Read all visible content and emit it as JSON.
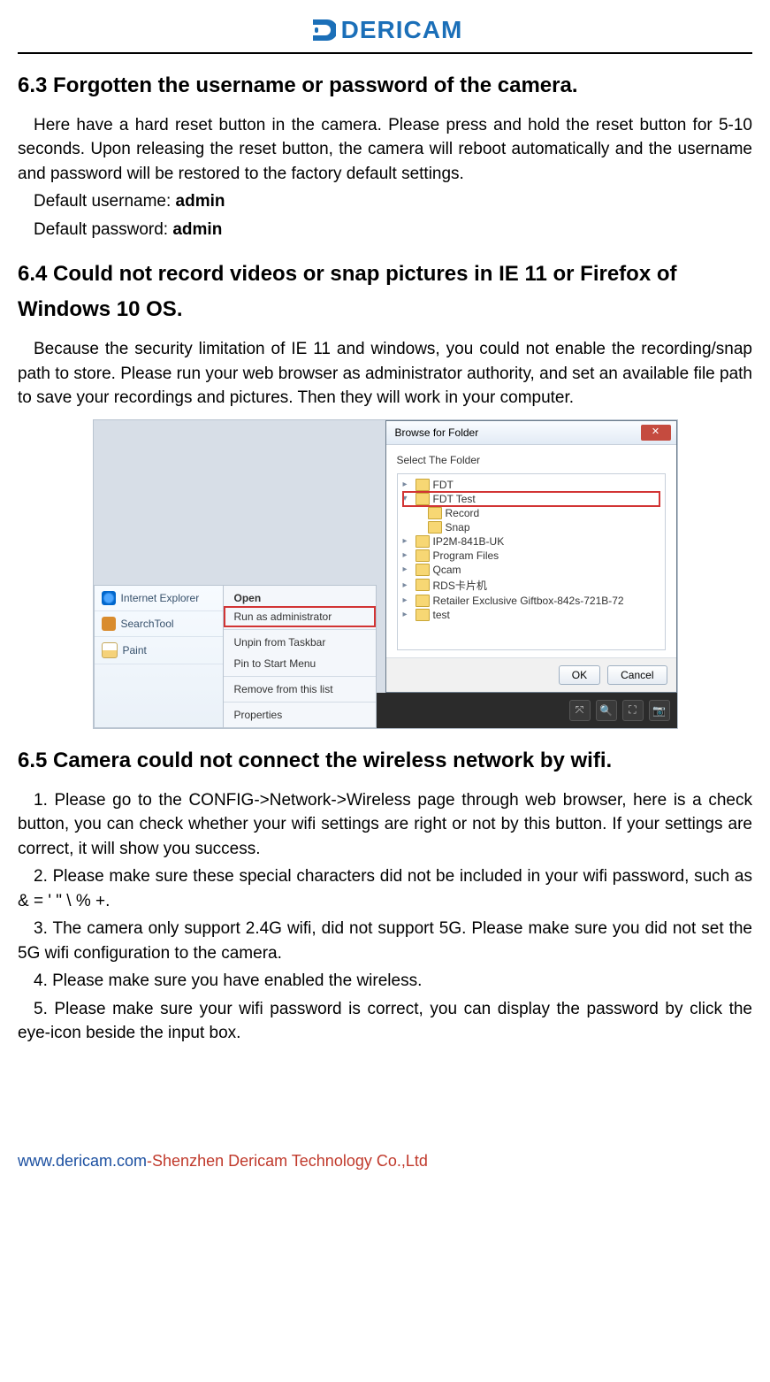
{
  "brand": {
    "name": "DERICAM"
  },
  "section63": {
    "title": "6.3 Forgotten the username or password of the camera.",
    "para1": "Here have a hard reset button in the camera. Please press and hold the reset button for 5-10 seconds. Upon releasing the reset button, the camera will reboot automatically and the username and password will be restored to the factory default settings.",
    "default_user_label": "Default username: ",
    "default_user_value": "admin",
    "default_pass_label": "Default password: ",
    "default_pass_value": "admin"
  },
  "section64": {
    "title": "6.4 Could not record videos or snap pictures in IE 11 or Firefox of Windows 10 OS.",
    "para1": "Because the security limitation of IE 11 and windows, you could not enable the recording/snap path to store. Please run your web browser as administrator authority, and set an available file path to save your recordings and pictures. Then they will work in your computer."
  },
  "taskbar": {
    "items": [
      {
        "label": "Internet Explorer"
      },
      {
        "label": "SearchTool"
      },
      {
        "label": "Paint"
      }
    ]
  },
  "context_menu": {
    "header": "Open",
    "run_as_admin": "Run as administrator",
    "unpin": "Unpin from Taskbar",
    "pin_start": "Pin to Start Menu",
    "remove": "Remove from this list",
    "properties": "Properties"
  },
  "dialog": {
    "title": "Browse for Folder",
    "label": "Select The Folder",
    "ok": "OK",
    "cancel": "Cancel",
    "tree": {
      "n0": "FDT",
      "n1": "FDT Test",
      "n2": "Record",
      "n3": "Snap",
      "n4": "IP2M-841B-UK",
      "n5": "Program Files",
      "n6": "Qcam",
      "n7": "RDS卡片机",
      "n8": "Retailer Exclusive Giftbox-842s-721B-72",
      "n9": "test"
    }
  },
  "section65": {
    "title": "6.5 Camera could not connect the wireless network by wifi.",
    "p1": "1. Please go to the CONFIG->Network->Wireless page through web browser, here is a check button, you can check whether your wifi settings are right or not by this button. If your settings are correct, it will show you success.",
    "p2": "2. Please make sure these special characters did not be included in your wifi password, such as & = ' \" \\ % +.",
    "p3": "3. The camera only support 2.4G wifi, did not support 5G. Please make sure you did not set the 5G wifi configuration to the camera.",
    "p4": "4. Please make sure you have enabled the wireless.",
    "p5": "5. Please make sure your wifi password is correct, you can display the password by click the eye-icon beside the input box."
  },
  "footer": {
    "url": "www.dericam.com",
    "dash": "-",
    "company": "Shenzhen Dericam Technology Co.,Ltd"
  }
}
